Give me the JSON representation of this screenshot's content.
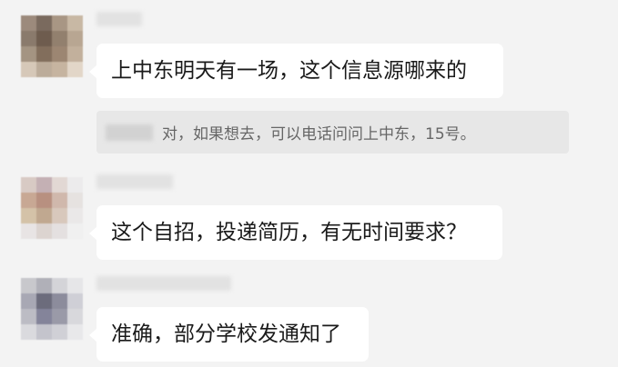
{
  "messages": [
    {
      "text": "上中东明天有一场，这个信息源哪来的"
    },
    {
      "text": "这个自招，投递简历，有无时间要求？"
    },
    {
      "text": "准确，部分学校发通知了"
    }
  ],
  "quote": {
    "text": "对，如果想去，可以电话问问上中东，15号。"
  },
  "avatars": [
    [
      "#9c8a7c",
      "#7a6a5e",
      "#a89684",
      "#c8b8a4",
      "#8a7a6c",
      "#6e5c4e",
      "#92806e",
      "#b8a692",
      "#a49482",
      "#826e5c",
      "#9c8672",
      "#c2b09c",
      "#d6c8b8",
      "#bcac9a",
      "#c6b4a0",
      "#e2d6c8"
    ],
    [
      "#d8cac4",
      "#c4b0b4",
      "#e2d8d4",
      "#ecebec",
      "#c8a894",
      "#b89080",
      "#d0b8ac",
      "#e6e2e0",
      "#d4c2a8",
      "#c0a890",
      "#d8c8bc",
      "#eae8e8",
      "#e8e4e4",
      "#dcd4d0",
      "#e4e0e0",
      "#f0f0f0"
    ],
    [
      "#c8c8cc",
      "#b0b0b8",
      "#d4d4d8",
      "#e6e6e8",
      "#a8a8b4",
      "#6c6c7c",
      "#8c8c9c",
      "#cfcfd6",
      "#bcbcc4",
      "#84849a",
      "#9a9aa8",
      "#d8d8dc",
      "#dadade",
      "#c4c4cc",
      "#d0d0d6",
      "#e8e8ea"
    ]
  ]
}
